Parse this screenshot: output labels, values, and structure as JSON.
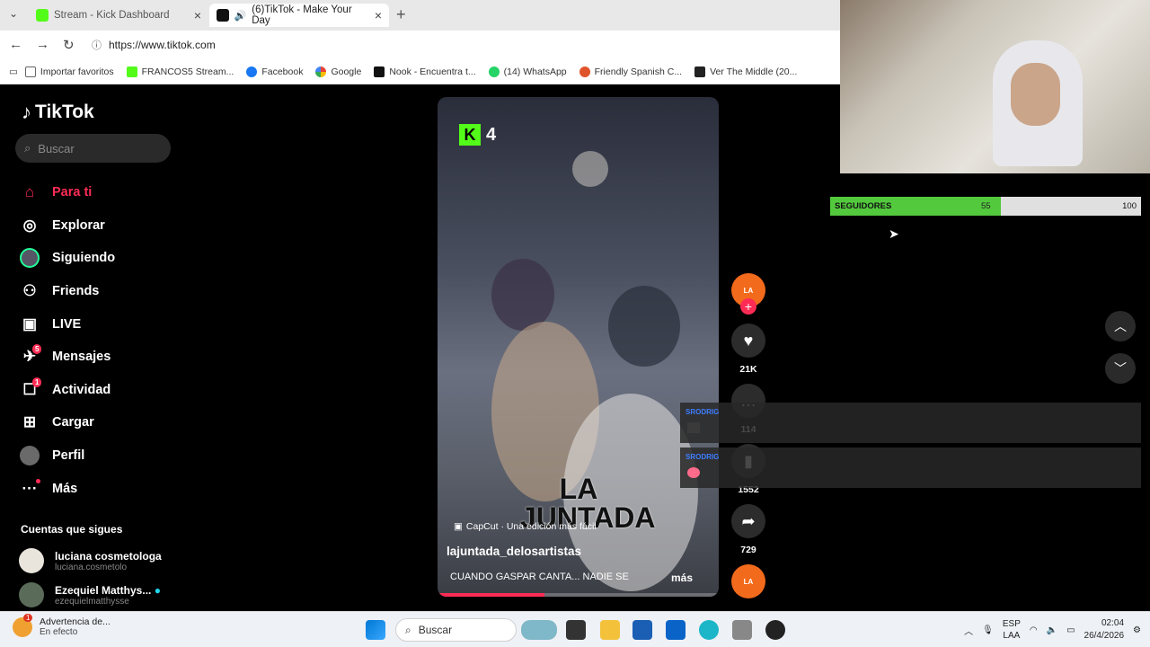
{
  "browser": {
    "tabs": [
      {
        "label": "Stream - Kick Dashboard",
        "active": false
      },
      {
        "label": "(6)TikTok - Make Your Day",
        "active": true
      }
    ],
    "url": "https://www.tiktok.com",
    "bookmarks": [
      {
        "label": "Importar favoritos",
        "icon": "import-icon"
      },
      {
        "label": "FRANCOS5 Stream...",
        "icon": "kick-icon"
      },
      {
        "label": "Facebook",
        "icon": "facebook-icon"
      },
      {
        "label": "Google",
        "icon": "google-icon"
      },
      {
        "label": "Nook - Encuentra t...",
        "icon": "nook-icon"
      },
      {
        "label": "(14) WhatsApp",
        "icon": "whatsapp-icon"
      },
      {
        "label": "Friendly Spanish C...",
        "icon": "spanish-icon"
      },
      {
        "label": "Ver The Middle (20...",
        "icon": "play-icon"
      }
    ]
  },
  "tiktok": {
    "logo": "TikTok",
    "search_placeholder": "Buscar",
    "nav": [
      {
        "label": "Para ti",
        "icon": "home-icon",
        "active": true
      },
      {
        "label": "Explorar",
        "icon": "compass-icon"
      },
      {
        "label": "Siguiendo",
        "icon": "following-avatar-icon"
      },
      {
        "label": "Friends",
        "icon": "friends-icon"
      },
      {
        "label": "LIVE",
        "icon": "live-icon"
      },
      {
        "label": "Mensajes",
        "icon": "messages-icon",
        "badge": "5"
      },
      {
        "label": "Actividad",
        "icon": "activity-icon",
        "badge": "1"
      },
      {
        "label": "Cargar",
        "icon": "upload-icon"
      },
      {
        "label": "Perfil",
        "icon": "profile-avatar-icon"
      },
      {
        "label": "Más",
        "icon": "more-icon",
        "dot": true
      }
    ],
    "following_title": "Cuentas que sigues",
    "following": [
      {
        "name": "luciana cosmetologa",
        "handle": "luciana.cosmetolo"
      },
      {
        "name": "Ezequiel Matthys...",
        "handle": "ezequielmatthysse",
        "verified": true
      }
    ],
    "video": {
      "kick_count": "4",
      "capcut": "CapCut · Una edición más fácil",
      "author": "lajuntada_delosartistas",
      "caption": "CUANDO GASPAR CANTA... NADIE SE",
      "more": "más",
      "watermark": "LA JUNTADA",
      "progress": 0.38
    },
    "actions": {
      "likes": "21K",
      "comments": "114",
      "saves": "1552",
      "shares": "729"
    }
  },
  "overlay": {
    "followers_label": "SEGUIDORES",
    "followers_current": "55",
    "followers_goal": "100",
    "followers_fraction": 0.55,
    "chat_user": "SRODRIG"
  },
  "taskbar": {
    "notif_title": "Advertencia de...",
    "notif_sub": "En efecto",
    "notif_badge": "1",
    "search": "Buscar",
    "lang1": "ESP",
    "lang2": "LAA",
    "time": "02:04",
    "date": "26/4/2026"
  },
  "colors": {
    "tiktok_accent": "#fe2c55",
    "kick_green": "#53fc18",
    "followers_fill": "#53c93d"
  }
}
